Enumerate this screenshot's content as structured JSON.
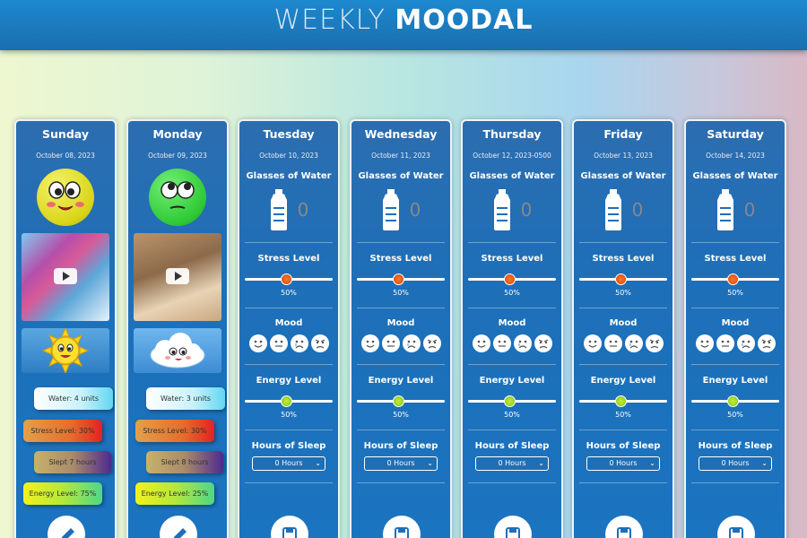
{
  "header": {
    "title_light": "WEEKLY",
    "title_bold": "MOODAL"
  },
  "labels": {
    "water": "Glasses of Water",
    "stress": "Stress Level",
    "mood": "Mood",
    "energy": "Energy Level",
    "sleep": "Hours of Sleep"
  },
  "logged_days": [
    {
      "name": "Sunday",
      "date": "October 08, 2023",
      "face": "yellow-blushing-face-icon",
      "weather": "sun-icon",
      "water_label": "Water: 4 units",
      "stress_label": "Stress Level: 30%",
      "sleep_label": "Slept 7 hours",
      "energy_label": "Energy Level: 75%"
    },
    {
      "name": "Monday",
      "date": "October 09, 2023",
      "face": "green-rolling-eyes-face-icon",
      "weather": "cloud-icon",
      "water_label": "Water: 3 units",
      "stress_label": "Stress Level: 30%",
      "sleep_label": "Slept 8 hours",
      "energy_label": "Energy Level: 25%"
    }
  ],
  "form_days": [
    {
      "name": "Tuesday",
      "date": "October 10, 2023",
      "water_value": "0",
      "stress_value": "50%",
      "energy_value": "50%",
      "sleep_option": "0 Hours"
    },
    {
      "name": "Wednesday",
      "date": "October 11, 2023",
      "water_value": "0",
      "stress_value": "50%",
      "energy_value": "50%",
      "sleep_option": "0 Hours"
    },
    {
      "name": "Thursday",
      "date": "October 12, 2023-0500",
      "water_value": "0",
      "stress_value": "50%",
      "energy_value": "50%",
      "sleep_option": "0 Hours"
    },
    {
      "name": "Friday",
      "date": "October 13, 2023",
      "water_value": "0",
      "stress_value": "50%",
      "energy_value": "50%",
      "sleep_option": "0 Hours"
    },
    {
      "name": "Saturday",
      "date": "October 14, 2023",
      "water_value": "0",
      "stress_value": "50%",
      "energy_value": "50%",
      "sleep_option": "0 Hours"
    }
  ],
  "colors": {
    "header": "#1d88cf",
    "card": "#1d6fb8",
    "stress_thumb": "#e85a1c",
    "energy_thumb": "#9bd22a"
  }
}
